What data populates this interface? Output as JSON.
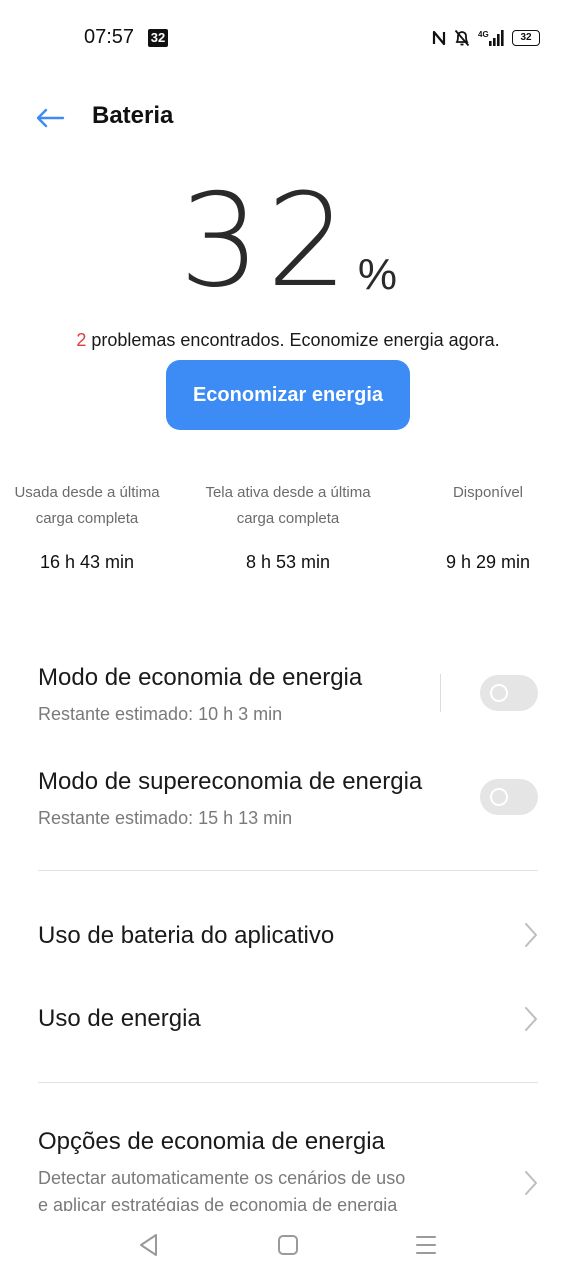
{
  "status_bar": {
    "time": "07:57",
    "notification_badge": "32",
    "battery": "32",
    "network": "4G",
    "icons": [
      "nfc-icon",
      "notifications-off-icon",
      "signal-4g-icon",
      "battery-icon"
    ]
  },
  "header": {
    "title": "Bateria",
    "back_icon": "arrow-left-icon"
  },
  "battery_level": {
    "value": "32",
    "unit": "%"
  },
  "problems": {
    "count": "2",
    "text": " problemas encontrados. Economize energia agora."
  },
  "save_button": {
    "label": "Economizar energia"
  },
  "stats": [
    {
      "label_line1": "Usada desde a última",
      "label_line2": "carga completa",
      "value": "16 h 43 min"
    },
    {
      "label_line1": "Tela ativa desde a última",
      "label_line2": "carga completa",
      "value": "8 h 53 min"
    },
    {
      "label_line1": "Disponível",
      "label_line2": "",
      "value": "9 h 29 min"
    }
  ],
  "power_saving": {
    "title": "Modo de economia de energia",
    "subtitle": "Restante estimado:  10 h 3 min",
    "enabled": false
  },
  "super_power_saving": {
    "title": "Modo de supereconomia de energia",
    "subtitle": "Restante estimado:  15 h 13 min",
    "enabled": false
  },
  "menu": {
    "app_battery_usage": "Uso de bateria do aplicativo",
    "power_usage": "Uso de energia"
  },
  "options": {
    "title": "Opções de economia de energia",
    "desc_line1": "Detectar automaticamente os cenários de uso",
    "desc_line2": "e aplicar estratégias de economia de energia"
  },
  "colors": {
    "accent": "#3d8bf5",
    "problem_count": "#e03b3b",
    "toggle_off": "#e5e5e5"
  },
  "nav_icons": [
    "back-triangle-icon",
    "home-square-icon",
    "menu-lines-icon"
  ]
}
